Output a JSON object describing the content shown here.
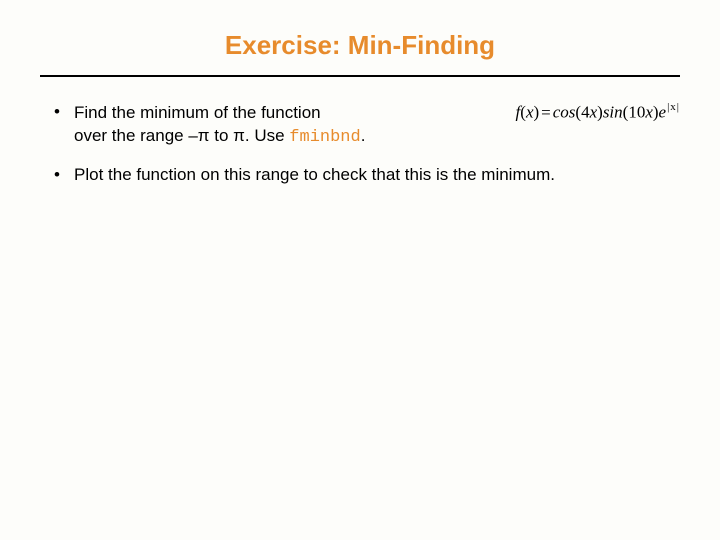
{
  "title": "Exercise: Min-Finding",
  "bullets": [
    {
      "line1_text": "Find the minimum of the function",
      "formula": {
        "lhs_f": "f",
        "lhs_var": "x",
        "rhs_cos": "cos",
        "rhs_cos_arg_coef": "4",
        "rhs_cos_arg_var": "x",
        "rhs_sin": "sin",
        "rhs_sin_arg_coef": "10",
        "rhs_sin_arg_var": "x",
        "rhs_e": "e",
        "rhs_exp_abs_var": "x"
      },
      "line2_pre": "over the range –π to π. Use ",
      "line2_code": "fminbnd",
      "line2_post": "."
    },
    {
      "text": "Plot the function on this range to check that this is the minimum."
    }
  ]
}
